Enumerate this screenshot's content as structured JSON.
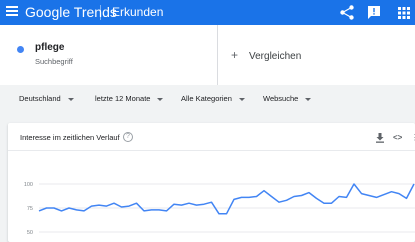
{
  "appbar": {
    "brand_google": "Google",
    "brand_trends": "Trends",
    "nav_label": "Erkunden",
    "icons": [
      "menu-icon",
      "share-icon",
      "feedback-icon",
      "apps-icon"
    ]
  },
  "compare": {
    "term": "pflege",
    "term_type": "Suchbegriff",
    "term_color": "#4285f4",
    "add_label": "Vergleichen"
  },
  "filters": {
    "region": "Deutschland",
    "period": "letzte 12 Monate",
    "category": "Alle Kategorien",
    "search_type": "Websuche"
  },
  "interest_card": {
    "title": "Interesse im zeitlichen Verlauf",
    "help_symbol": "?",
    "embed_symbol": "<>",
    "more_symbol": "⋮"
  },
  "chart_data": {
    "type": "line",
    "ylim": [
      0,
      100
    ],
    "y_ticks": [
      "100",
      "75",
      "50"
    ],
    "grid": true,
    "series": [
      {
        "color": "#4285f4",
        "values": [
          72,
          75,
          75,
          72,
          75,
          73,
          72,
          77,
          78,
          77,
          80,
          76,
          77,
          80,
          72,
          73,
          73,
          72,
          79,
          78,
          80,
          78,
          79,
          81,
          69,
          69,
          84,
          86,
          86,
          87,
          93,
          87,
          81,
          83,
          87,
          88,
          91,
          85,
          80,
          80,
          87,
          86,
          100,
          90,
          88,
          86,
          89,
          92,
          90,
          85,
          100
        ]
      }
    ]
  }
}
